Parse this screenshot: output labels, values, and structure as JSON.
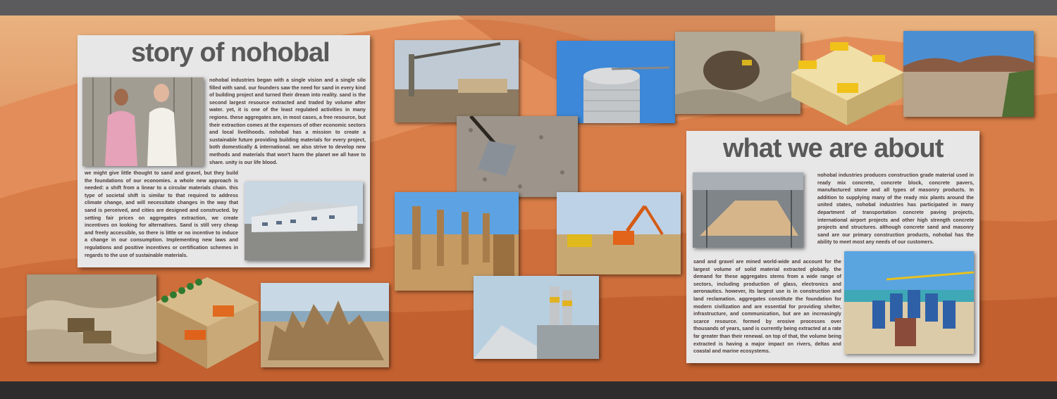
{
  "story": {
    "title": "story of nohobal",
    "para1": "nohobal industries began with a single vision and a single silo filled with sand. our founders saw the need for sand in every kind of building project and turned their dream into reality. sand is the second largest resource extracted and traded by volume after water. yet, it is one of the least regulated activities in many regions. these aggregates are, in most cases, a free resource, but their extraction comes at the expenses of other economic sectors and local livelihoods. nohobal has a mission to create a sustainable future providing building materials for every project, both domestically & international. we also strive to develop new methods and materials that won't harm the planet we all have to share. unity is our life blood.",
    "para2": "we might give little thought to sand and gravel, but they build the foundations of our economies. a whole new approach is needed: a shift from a linear to a circular materials chain. this type of societal shift is similar to that required to address climate change, and will necessitate changes in the way that sand is perceived, and cities are designed and constructed. by setting fair prices on aggregates extraction, we create incentives on looking for alternatives. Sand is still very cheap and freely accessible, so there is little or no incentive to induce a change in our consumption. Implementing new laws and regulations and positive incentives or certification schemes in regards to the use of sustainable materials."
  },
  "about": {
    "title": "what we are about",
    "para1": "nohobal industries produces construction grade material used in ready mix concrete, concrete block, concrete pavers, manufactured stone and all types of masonry products. In addition to supplying many of the ready mix plants around the united states, nohobal industries has participated in many department of transportation concrete paving projects, international airport projects and other high strength concrete projects and structures. although concrete sand and masonry sand are our primary construction products, nohobal has the ability to meet most any needs of our customers.",
    "para2": "sand and gravel are mined world-wide and account for the largest volume of solid material extracted globally. the demand for these aggregates stems from a wide range of sectors, including production of glass, electronics and aeronautics. however, its largest use is in construction and land reclamation. aggregates constitute the foundation for modern civilization and are essential for providing shelter, infrastructure, and communication, but are an increasingly scarce resource. formed by erosive processes over thousands of years, sand is currently being extracted at a rate far greater than their renewal. on top of that, the volume being extracted is having a major impact on rivers, deltas and coastal and marine ecosystems."
  },
  "colors": {
    "title": "#595959",
    "panel": "#e8e7e8",
    "text": "#4a3b36"
  }
}
